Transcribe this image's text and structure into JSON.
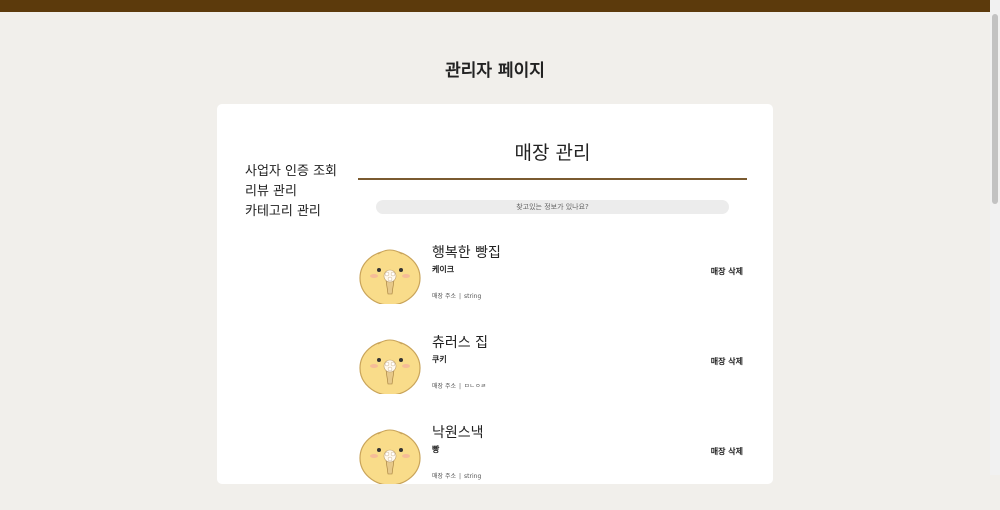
{
  "header": {
    "title": "관리자 페이지"
  },
  "sidebar": {
    "items": [
      {
        "label": "사업자 인증 조회"
      },
      {
        "label": "리뷰 관리"
      },
      {
        "label": "카테고리 관리"
      }
    ]
  },
  "main": {
    "title": "매장 관리",
    "search": {
      "placeholder": "찾고있는 정보가 있나요?"
    },
    "stores": [
      {
        "name": "행복한 빵집",
        "category": "케이크",
        "address_label": "매장 주소",
        "address": "string",
        "delete_label": "매장 삭제"
      },
      {
        "name": "츄러스 집",
        "category": "쿠키",
        "address_label": "매장 주소",
        "address": "ㅁㄴㅇㄹ",
        "delete_label": "매장 삭제"
      },
      {
        "name": "낙원스낵",
        "category": "빵",
        "address_label": "매장 주소",
        "address": "string",
        "delete_label": "매장 삭제"
      }
    ]
  },
  "colors": {
    "topbar": "#5c3a0c",
    "divider": "#7a5a30",
    "chick": "#f9dc8a"
  }
}
